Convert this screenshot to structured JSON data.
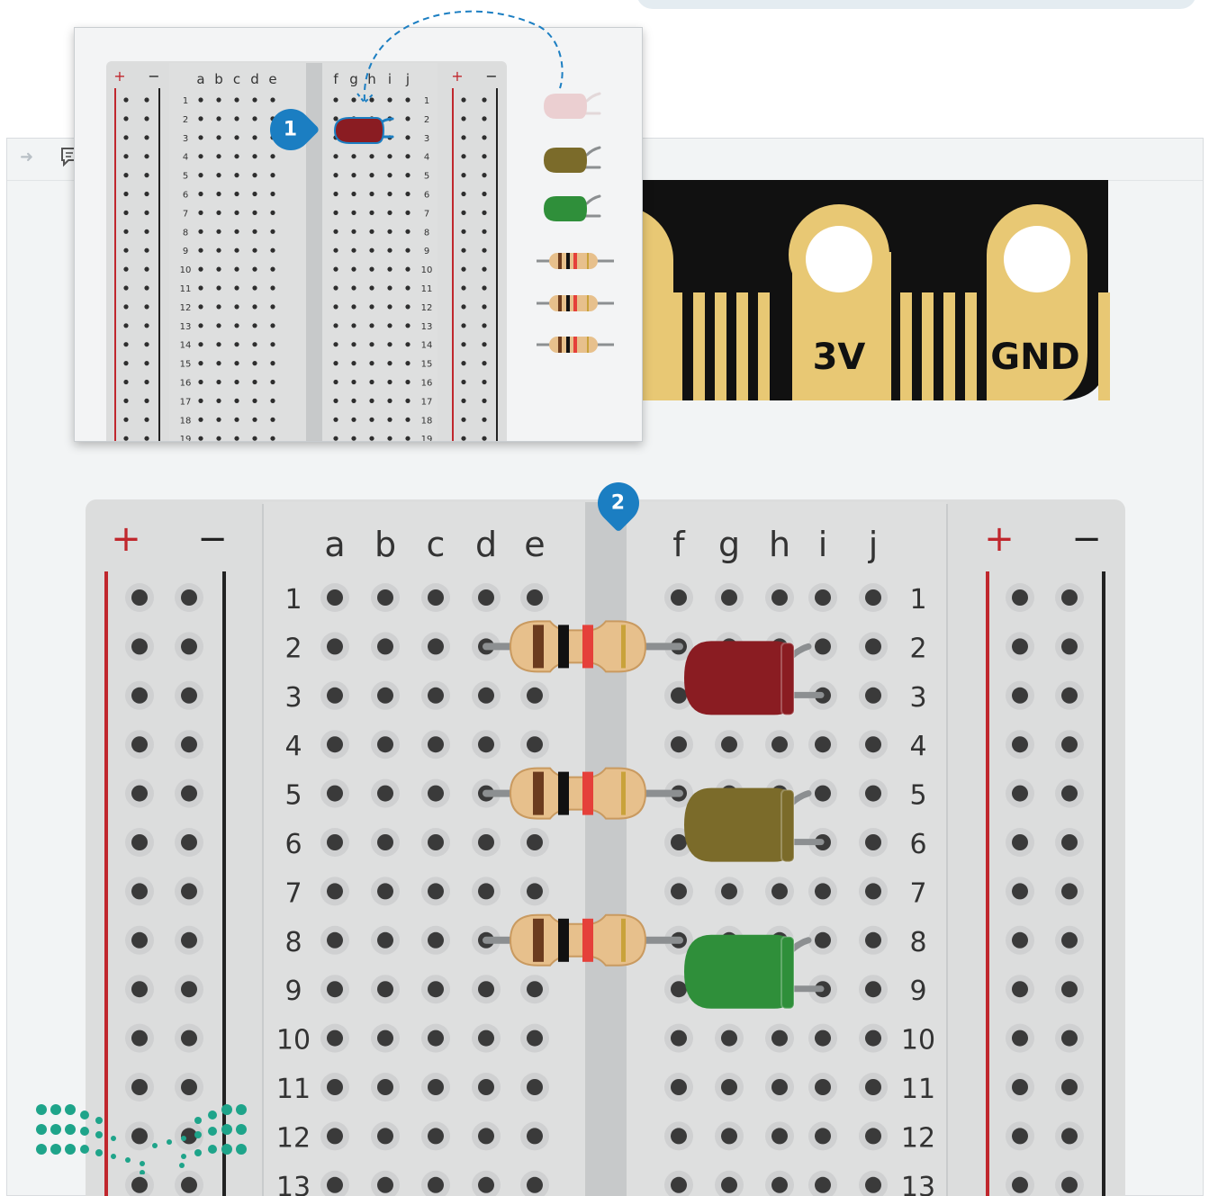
{
  "board": {
    "columns_left": [
      "a",
      "b",
      "c",
      "d",
      "e"
    ],
    "columns_right": [
      "f",
      "g",
      "h",
      "i",
      "j"
    ],
    "rail_plus": "+",
    "rail_minus": "−"
  },
  "microbit_pins": {
    "pin_3v": "3V",
    "pin_gnd": "GND"
  },
  "steps": {
    "step1": "1",
    "step2": "2"
  },
  "components": {
    "leds": [
      {
        "name": "red-led",
        "color": "#8a1c22"
      },
      {
        "name": "olive-led",
        "color": "#7b6b2a"
      },
      {
        "name": "green-led",
        "color": "#2f8f3a"
      }
    ],
    "resistor_band_colors": [
      "#6b3b1e",
      "#111111",
      "#e5403a",
      "#c9a23a"
    ],
    "resistor_body_color": "#e7c08c"
  },
  "colors": {
    "board_bg": "#dcdddd",
    "rail_red": "#c0272d",
    "rail_black": "#222222",
    "hole": "#3a3a3a",
    "accent_blue": "#1b7ec2",
    "pcb_black": "#111111",
    "pcb_gold": "#e8c874"
  }
}
